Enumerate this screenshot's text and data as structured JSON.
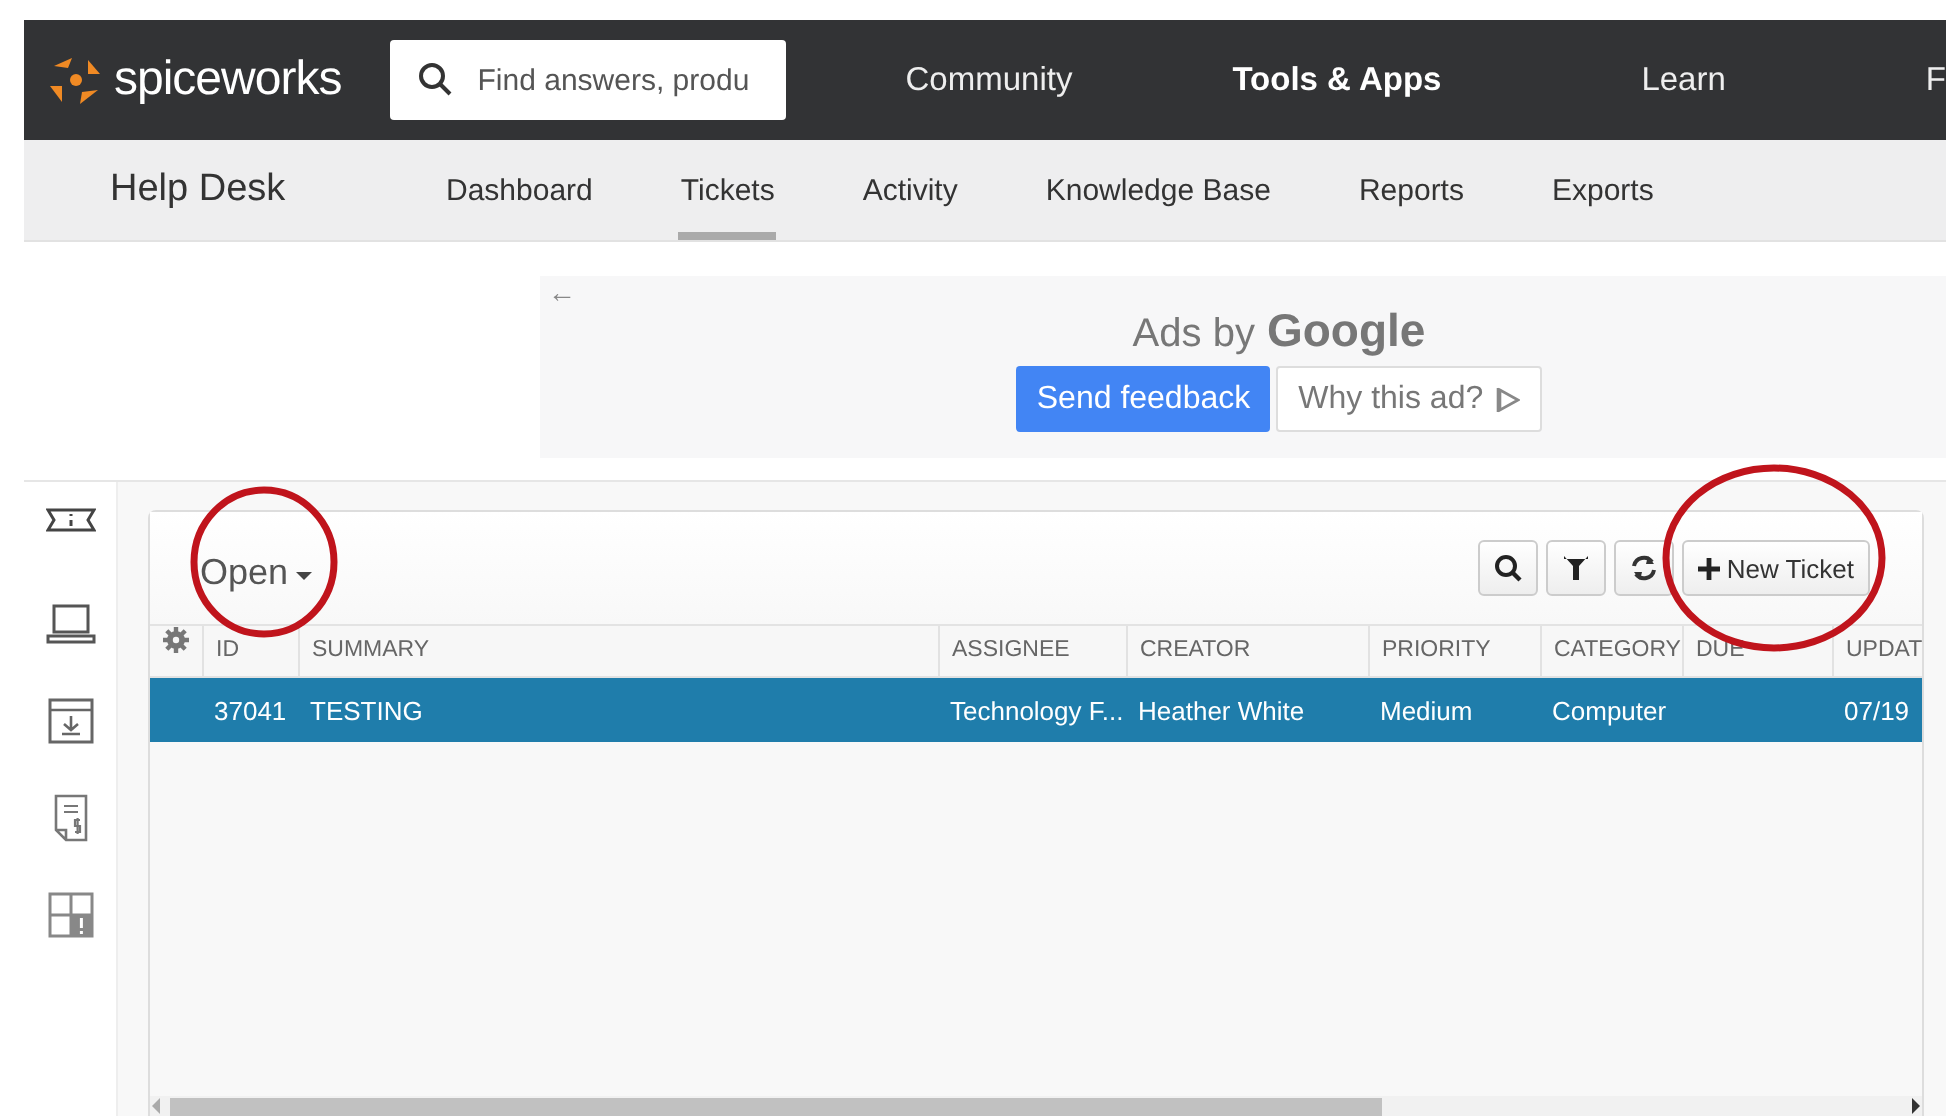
{
  "header": {
    "brand": "spiceworks",
    "search": {
      "placeholder": "Find answers, produ"
    },
    "nav": [
      {
        "label": "Community",
        "selected": false
      },
      {
        "label": "Tools & Apps",
        "selected": true
      },
      {
        "label": "Learn",
        "selected": false
      },
      {
        "label": "F",
        "selected": false
      }
    ]
  },
  "subnav": {
    "title": "Help Desk",
    "tabs": [
      {
        "label": "Dashboard",
        "selected": false
      },
      {
        "label": "Tickets",
        "selected": true
      },
      {
        "label": "Activity",
        "selected": false
      },
      {
        "label": "Knowledge Base",
        "selected": false
      },
      {
        "label": "Reports",
        "selected": false
      },
      {
        "label": "Exports",
        "selected": false
      }
    ]
  },
  "ad": {
    "back": "←",
    "caption": "Ads by",
    "brand": "Google",
    "buttons": [
      {
        "label": "Send feedback",
        "kind": "primary"
      },
      {
        "label": "Why this ad?",
        "kind": "info"
      }
    ]
  },
  "sidebar": {
    "items": [
      {
        "kind": "ticket"
      },
      {
        "kind": "laptop"
      },
      {
        "kind": "download"
      },
      {
        "kind": "receipt"
      },
      {
        "kind": "alert-grid"
      }
    ]
  },
  "tickets": {
    "filter": "Open",
    "toolbar": [
      {
        "kind": "search"
      },
      {
        "kind": "filter"
      },
      {
        "kind": "refresh"
      },
      {
        "kind": "new",
        "label": "New Ticket"
      }
    ],
    "columns": [
      "ID",
      "SUMMARY",
      "ASSIGNEE",
      "CREATOR",
      "PRIORITY",
      "CATEGORY",
      "DUE",
      "UPDAT"
    ],
    "rows": [
      {
        "selected": true,
        "cells": [
          "37041",
          "TESTING",
          "Technology F...",
          "Heather White",
          "Medium",
          "Computer",
          "",
          "07/19"
        ]
      }
    ]
  },
  "annotations": [
    {
      "kind": "circle"
    },
    {
      "kind": "circle"
    }
  ]
}
